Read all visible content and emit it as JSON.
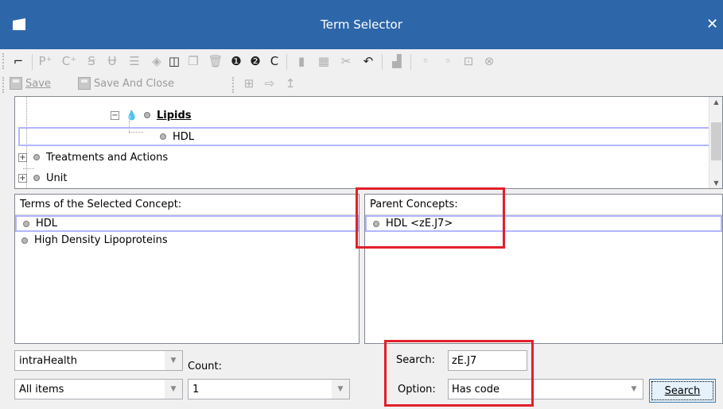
{
  "window": {
    "title": "Term Selector",
    "close_glyph": "✕",
    "top_note": "top-right edge"
  },
  "toolbar_save": {
    "save_label": "Save",
    "save_and_close_label": "Save And Close"
  },
  "tree": {
    "items": [
      {
        "label": "Lipids",
        "icon": "drop-icon",
        "expanded": true,
        "style": "bold-underline"
      },
      {
        "label": "HDL",
        "selected": true
      },
      {
        "label": "Treatments and Actions",
        "expander": "+"
      },
      {
        "label": "Unit",
        "expander": "+"
      }
    ]
  },
  "terms_panel": {
    "header": "Terms of the Selected Concept:",
    "items": [
      "HDL",
      "High Density Lipoproteins"
    ]
  },
  "parents_panel": {
    "header": "Parent Concepts:",
    "items": [
      "HDL <zE.J7>"
    ]
  },
  "filters": {
    "source_value": "intraHealth",
    "count_label": "Count:",
    "scope_value": "All items",
    "count_value": "1"
  },
  "search": {
    "label": "Search:",
    "value": "zE.J7",
    "option_label": "Option:",
    "option_value": "Has code",
    "button_label": "Search"
  },
  "colors": {
    "titlebar": "#2d66a9",
    "highlight_box": "#e0202a",
    "selection_border": "#b3b6ff"
  }
}
